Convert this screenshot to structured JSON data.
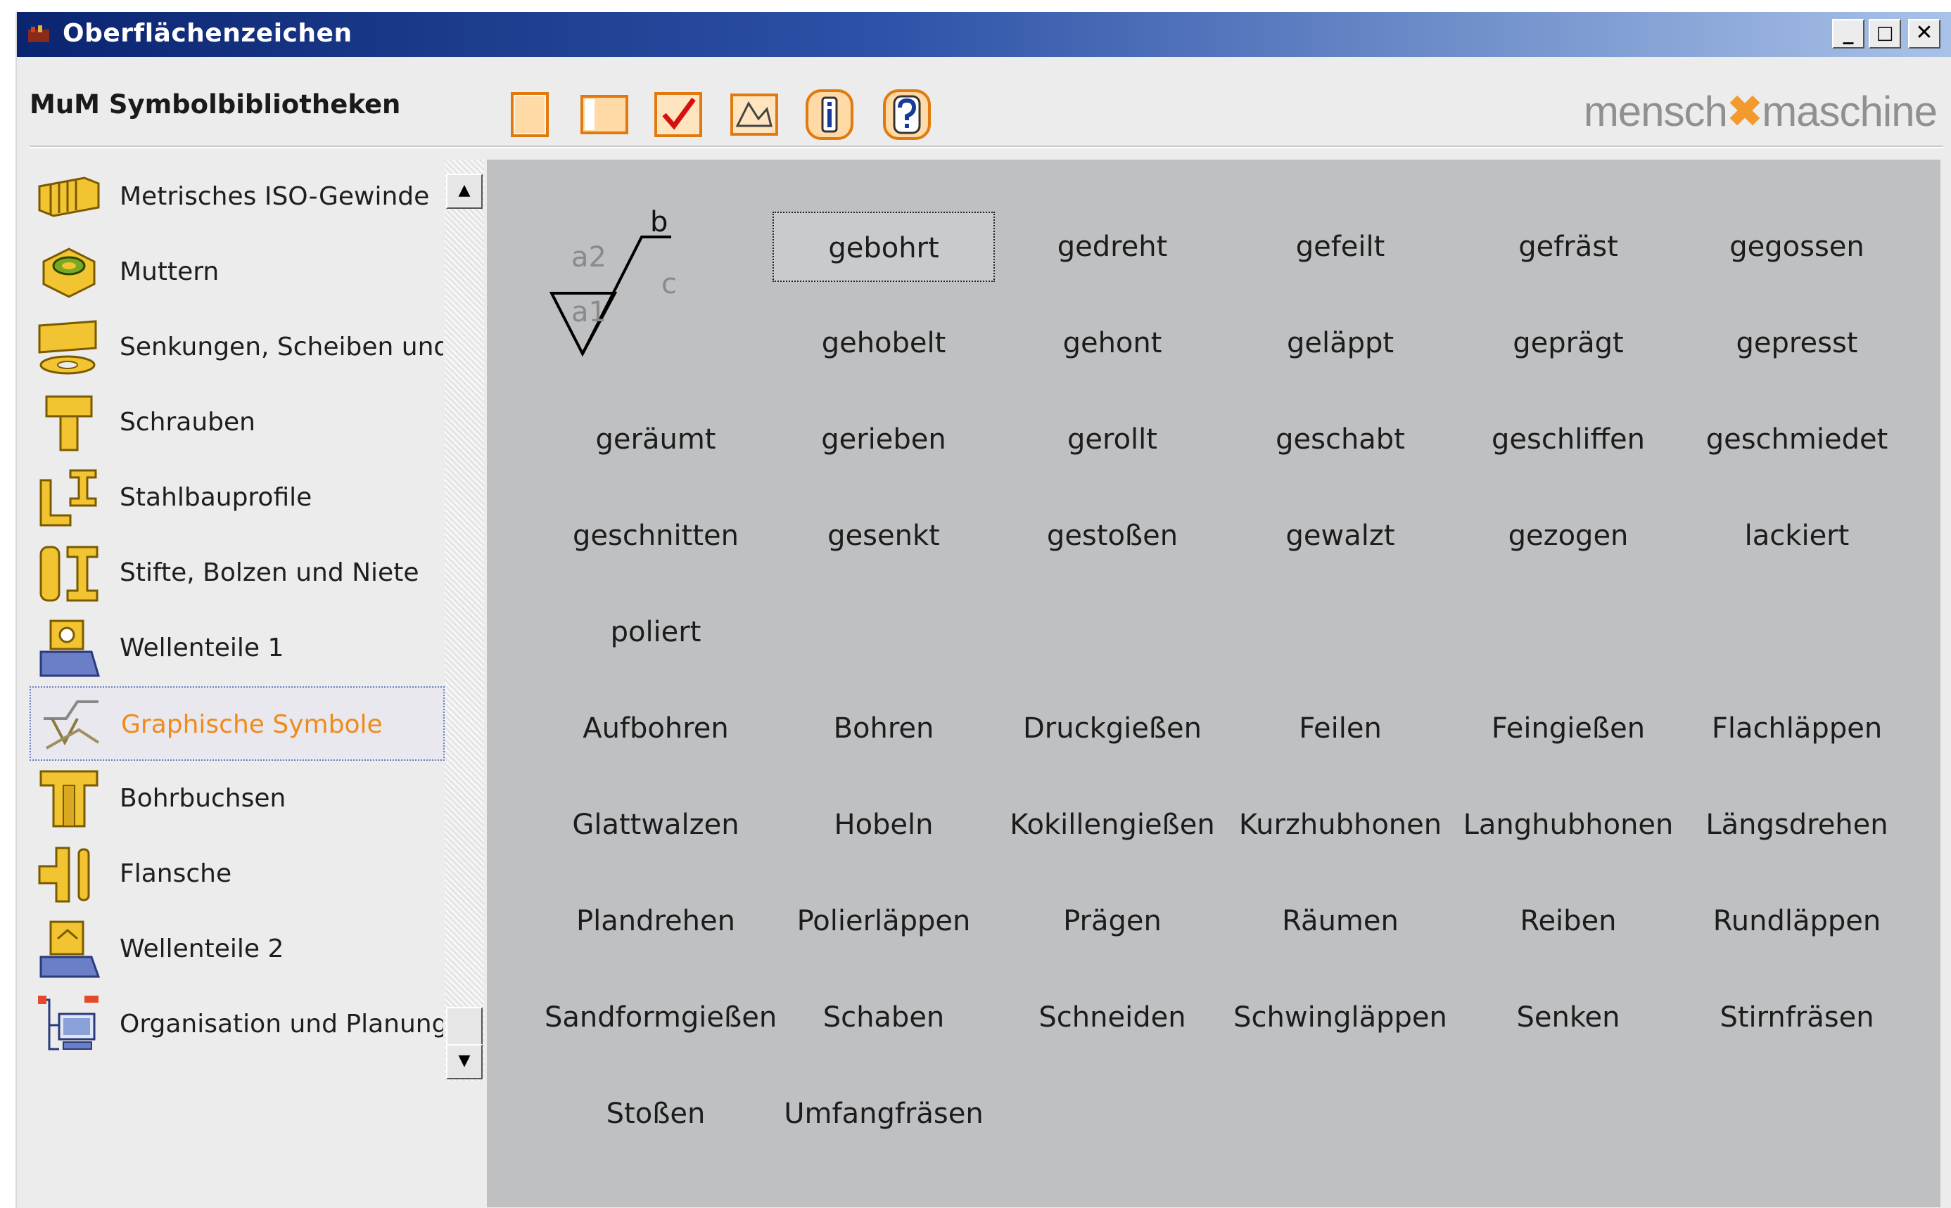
{
  "window": {
    "title": "Oberflächenzeichen",
    "minimize": "_",
    "maximize": "□",
    "close": "✕"
  },
  "toolbar": {
    "label": "MuM Symbolbibliotheken"
  },
  "brand": {
    "part1": "mensch",
    "sep": "✖",
    "part2": "maschine"
  },
  "sidebar": {
    "items": [
      {
        "label": "Metrisches ISO-Gewinde"
      },
      {
        "label": "Muttern"
      },
      {
        "label": "Senkungen, Scheiben und Du"
      },
      {
        "label": "Schrauben"
      },
      {
        "label": "Stahlbauprofile"
      },
      {
        "label": "Stifte, Bolzen und Niete"
      },
      {
        "label": "Wellenteile 1"
      },
      {
        "label": "Graphische Symbole"
      },
      {
        "label": "Bohrbuchsen"
      },
      {
        "label": "Flansche"
      },
      {
        "label": "Wellenteile 2"
      },
      {
        "label": "Organisation und Planung"
      }
    ],
    "selected": 7
  },
  "scroll": {
    "up": "▲",
    "down": "▼"
  },
  "symbol": {
    "a2": "a2",
    "a1": "a1",
    "b": "b",
    "c": "c"
  },
  "grid": [
    [
      "gebohrt",
      "gedreht",
      "gefeilt",
      "gefräst",
      "gegossen"
    ],
    [
      "gehobelt",
      "gehont",
      "geläppt",
      "geprägt",
      "gepresst"
    ],
    [
      "geräumt",
      "gerieben",
      "gerollt",
      "geschabt",
      "geschliffen",
      "geschmiedet"
    ],
    [
      "geschnitten",
      "gesenkt",
      "gestoßen",
      "gewalzt",
      "gezogen",
      "lackiert"
    ],
    [
      "poliert"
    ],
    [
      "Aufbohren",
      "Bohren",
      "Druckgießen",
      "Feilen",
      "Feingießen",
      "Flachläppen"
    ],
    [
      "Glattwalzen",
      "Hobeln",
      "Kokillengießen",
      "Kurzhubhonen",
      "Langhubhonen",
      "Längsdrehen"
    ],
    [
      "Plandrehen",
      "Polierläppen",
      "Prägen",
      "Räumen",
      "Reiben",
      "Rundläppen"
    ],
    [
      "Sandformgießen",
      "Schaben",
      "Schneiden",
      "Schwingläppen",
      "Senken",
      "Stirnfräsen"
    ],
    [
      "Stoßen",
      "Umfangfräsen"
    ]
  ],
  "colors": {
    "accent": "#f08a1a",
    "titlebar": "#0a2470",
    "content_bg": "#bfc0c2"
  }
}
